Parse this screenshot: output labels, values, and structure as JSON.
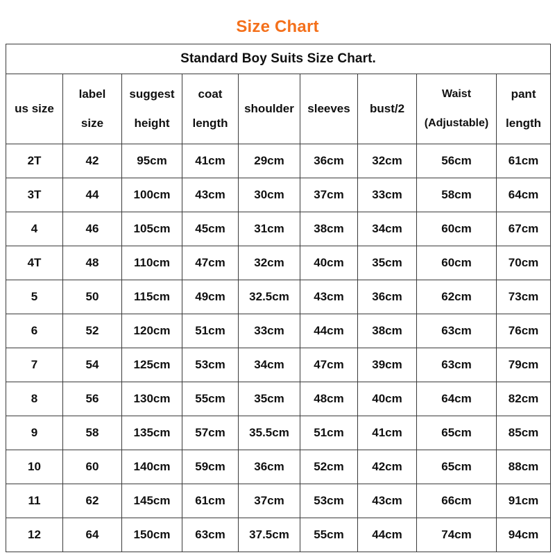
{
  "title": "Size Chart",
  "title_color": "#F4701B",
  "table": {
    "subtitle": "Standard Boy Suits Size Chart.",
    "headers": [
      {
        "line1": "us size",
        "line2": ""
      },
      {
        "line1": "label",
        "line2": "size"
      },
      {
        "line1": "suggest",
        "line2": "height"
      },
      {
        "line1": "coat",
        "line2": "length"
      },
      {
        "line1": "shoulder",
        "line2": ""
      },
      {
        "line1": "sleeves",
        "line2": ""
      },
      {
        "line1": "bust/2",
        "line2": ""
      },
      {
        "line1": "Waist",
        "line2": "(Adjustable)"
      },
      {
        "line1": "pant",
        "line2": "length"
      }
    ],
    "rows": [
      [
        "2T",
        "42",
        "95cm",
        "41cm",
        "29cm",
        "36cm",
        "32cm",
        "56cm",
        "61cm"
      ],
      [
        "3T",
        "44",
        "100cm",
        "43cm",
        "30cm",
        "37cm",
        "33cm",
        "58cm",
        "64cm"
      ],
      [
        "4",
        "46",
        "105cm",
        "45cm",
        "31cm",
        "38cm",
        "34cm",
        "60cm",
        "67cm"
      ],
      [
        "4T",
        "48",
        "110cm",
        "47cm",
        "32cm",
        "40cm",
        "35cm",
        "60cm",
        "70cm"
      ],
      [
        "5",
        "50",
        "115cm",
        "49cm",
        "32.5cm",
        "43cm",
        "36cm",
        "62cm",
        "73cm"
      ],
      [
        "6",
        "52",
        "120cm",
        "51cm",
        "33cm",
        "44cm",
        "38cm",
        "63cm",
        "76cm"
      ],
      [
        "7",
        "54",
        "125cm",
        "53cm",
        "34cm",
        "47cm",
        "39cm",
        "63cm",
        "79cm"
      ],
      [
        "8",
        "56",
        "130cm",
        "55cm",
        "35cm",
        "48cm",
        "40cm",
        "64cm",
        "82cm"
      ],
      [
        "9",
        "58",
        "135cm",
        "57cm",
        "35.5cm",
        "51cm",
        "41cm",
        "65cm",
        "85cm"
      ],
      [
        "10",
        "60",
        "140cm",
        "59cm",
        "36cm",
        "52cm",
        "42cm",
        "65cm",
        "88cm"
      ],
      [
        "11",
        "62",
        "145cm",
        "61cm",
        "37cm",
        "53cm",
        "43cm",
        "66cm",
        "91cm"
      ],
      [
        "12",
        "64",
        "150cm",
        "63cm",
        "37.5cm",
        "55cm",
        "44cm",
        "74cm",
        "94cm"
      ]
    ]
  }
}
